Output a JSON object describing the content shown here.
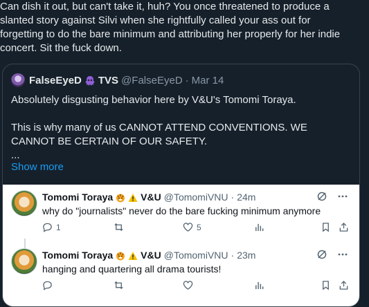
{
  "reply": {
    "text": "Can dish it out, but can't take it, huh? You once threatened to produce a slanted story against Silvi when she rightfully called your ass out for forgetting to do the bare minimum and attributing her properly for her indie concert. Sit the fuck down."
  },
  "quote": {
    "name_part1": "FalseEyeD",
    "name_part2": "TVS",
    "handle": "@FalseEyeD",
    "sep": "·",
    "date": "Mar 14",
    "line1": "Absolutely disgusting behavior here by V&U's Tomomi Toraya.",
    "line2": "This is why many of us CANNOT ATTEND CONVENTIONS. WE CANNOT BE CERTAIN OF OUR SAFETY.",
    "ellipsis": "...",
    "show_more": "Show more"
  },
  "embedded_tweets": [
    {
      "name": "Tomomi Toraya",
      "brand": "V&U",
      "handle": "@TomomiVNU",
      "sep": "·",
      "time": "24m",
      "text": "why do \"journalists\" never do the bare fucking minimum anymore",
      "replies": "1",
      "retweets": "",
      "likes": "5"
    },
    {
      "name": "Tomomi Toraya",
      "brand": "V&U",
      "handle": "@TomomiVNU",
      "sep": "·",
      "time": "23m",
      "text": "hanging and quartering all drama tourists!",
      "replies": "",
      "retweets": "",
      "likes": ""
    }
  ],
  "icons": [
    "purple-alien-emoji-icon",
    "tiger-face-emoji-icon",
    "warning-emoji-icon",
    "grok-icon",
    "more-icon",
    "reply-icon",
    "retweet-icon",
    "like-icon",
    "views-icon",
    "bookmark-icon",
    "share-icon"
  ],
  "colors": {
    "background": "#15202b",
    "link": "#1d9bf0",
    "muted": "#8b98a5",
    "embed_bg": "#ffffff"
  }
}
